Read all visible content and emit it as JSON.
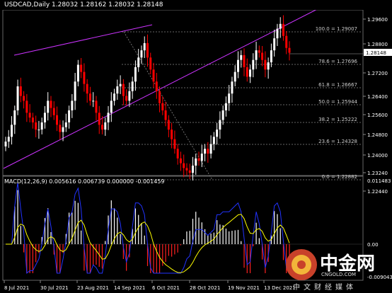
{
  "header": {
    "symbol": "USDCAD,Daily",
    "ohlc": "1.28032 1.28162 1.28032 1.28148"
  },
  "price_axis": {
    "ticks": [
      "1.29600",
      "1.28800",
      "1.28148",
      "1.27200",
      "1.26400",
      "1.25600",
      "1.24800",
      "1.24000",
      "1.23240",
      "1.22440"
    ],
    "current_label": "1.28148"
  },
  "macd": {
    "label": "MACD(12,26,9) 0.005616 0.006739 0.000000 -0.001459",
    "axis_ticks": [
      "0.011483",
      "0.00",
      "-0.009043"
    ]
  },
  "date_axis": {
    "labels": [
      "8 Jul 2021",
      "30 Jul 2021",
      "23 Aug 2021",
      "14 Sep 2021",
      "6 Oct 2021",
      "28 Oct 2021",
      "19 Nov 2021",
      "13 Dec 2021"
    ]
  },
  "fibonacci": [
    {
      "label": "100.0 = 1.29007"
    },
    {
      "label": "78.6 = 1.27696"
    },
    {
      "label": "61.8 = 1.26667"
    },
    {
      "label": "50.0 = 1.25944"
    },
    {
      "label": "38.2 = 1.25222"
    },
    {
      "label": "23.6 = 1.24328"
    },
    {
      "label": "0.0 = 1.22882"
    }
  ],
  "watermark": {
    "main": "中金网",
    "sub": "CNGOLD.COM",
    "cn": "中文财经媒体"
  },
  "colors": {
    "background": "#000000",
    "bull_candle": "#ffffff",
    "bear_candle": "#ff0000",
    "channel": "#cc33ff",
    "macd_line": "#2233ff",
    "signal_line": "#ffff00",
    "fib": "#888888",
    "axis_text": "#ffffff"
  },
  "chart_data": {
    "type": "candlestick",
    "title": "USDCAD,Daily",
    "ylim": [
      1.2212,
      1.2995
    ],
    "ohlc_last": [
      1.28032,
      1.28162,
      1.28032,
      1.28148
    ],
    "price_path": [
      1.245,
      1.247,
      1.252,
      1.258,
      1.268,
      1.264,
      1.262,
      1.257,
      1.255,
      1.253,
      1.25,
      1.25,
      1.253,
      1.257,
      1.262,
      1.259,
      1.256,
      1.252,
      1.249,
      1.251,
      1.253,
      1.258,
      1.262,
      1.27,
      1.277,
      1.274,
      1.269,
      1.265,
      1.262,
      1.262,
      1.257,
      1.252,
      1.25,
      1.253,
      1.257,
      1.262,
      1.265,
      1.268,
      1.269,
      1.264,
      1.262,
      1.266,
      1.27,
      1.276,
      1.28,
      1.283,
      1.286,
      1.28,
      1.275,
      1.27,
      1.266,
      1.261,
      1.258,
      1.254,
      1.25,
      1.246,
      1.242,
      1.238,
      1.236,
      1.234,
      1.233,
      1.232,
      1.235,
      1.238,
      1.237,
      1.24,
      1.242,
      1.24,
      1.244,
      1.247,
      1.25,
      1.254,
      1.258,
      1.261,
      1.265,
      1.27,
      1.274,
      1.279,
      1.281,
      1.276,
      1.272,
      1.275,
      1.279,
      1.283,
      1.282,
      1.279,
      1.275,
      1.278,
      1.283,
      1.288,
      1.292,
      1.294,
      1.289,
      1.284,
      1.282
    ]
  }
}
